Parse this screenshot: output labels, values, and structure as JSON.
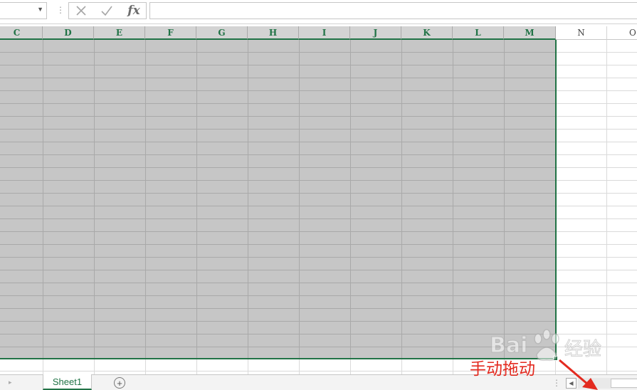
{
  "formula_bar": {
    "name_box_value": "",
    "formula_value": "",
    "fx_label": "fx"
  },
  "columns": [
    {
      "label": "C",
      "selected": true
    },
    {
      "label": "D",
      "selected": true
    },
    {
      "label": "E",
      "selected": true
    },
    {
      "label": "F",
      "selected": true
    },
    {
      "label": "G",
      "selected": true
    },
    {
      "label": "H",
      "selected": true
    },
    {
      "label": "I",
      "selected": true
    },
    {
      "label": "J",
      "selected": true
    },
    {
      "label": "K",
      "selected": true
    },
    {
      "label": "L",
      "selected": true
    },
    {
      "label": "M",
      "selected": true
    },
    {
      "label": "N",
      "selected": false
    },
    {
      "label": "O",
      "selected": false
    }
  ],
  "sheet_tabs": {
    "active_tab": "Sheet1",
    "add_sheet_symbol": "+"
  },
  "annotation": {
    "text": "手动拖动"
  },
  "watermark": {
    "text_brand": "Bai",
    "text_suffix": "经验"
  },
  "colors": {
    "accent_green": "#217346",
    "selection_fill": "#c6c6c6",
    "annotation_red": "#e32a1f"
  }
}
